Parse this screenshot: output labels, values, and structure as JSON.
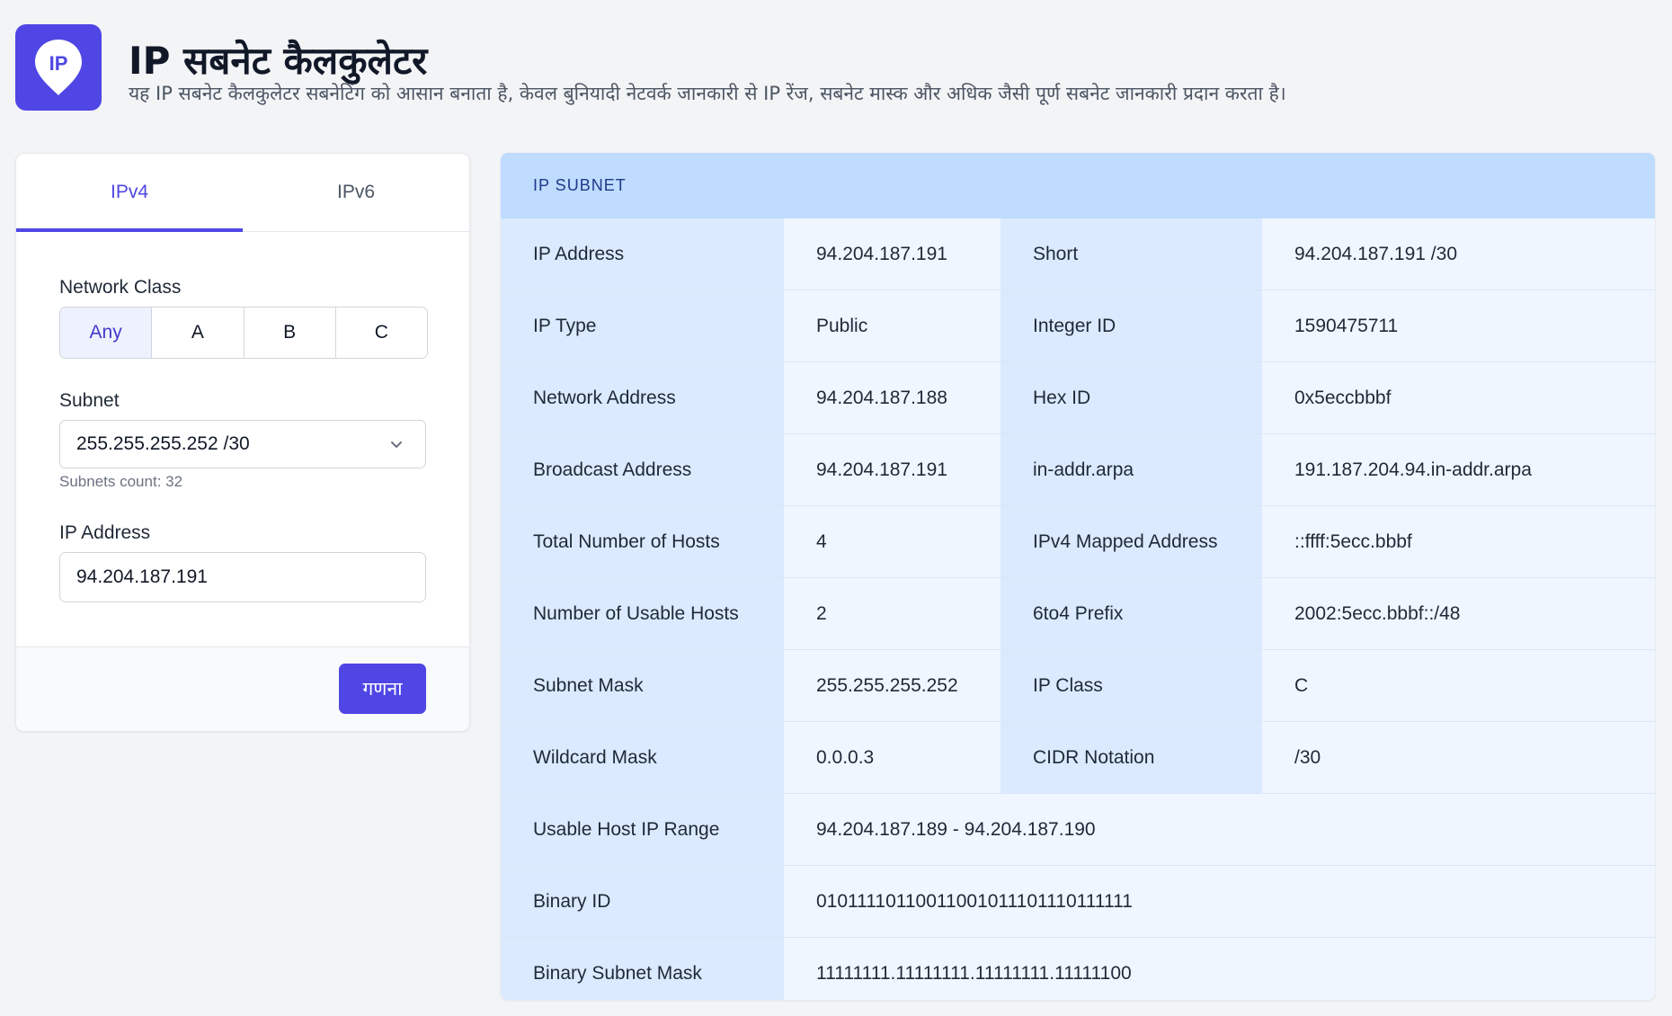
{
  "header": {
    "logo_text": "IP",
    "title": "IP सबनेट कैलकुलेटर",
    "subtitle": "यह IP सबनेट कैलकुलेटर सबनेटिंग को आसान बनाता है, केवल बुनियादी नेटवर्क जानकारी से IP रेंज, सबनेट मास्क और अधिक जैसी पूर्ण सबनेट जानकारी प्रदान करता है।"
  },
  "form": {
    "tabs": [
      {
        "label": "IPv4",
        "active": true
      },
      {
        "label": "IPv6",
        "active": false
      }
    ],
    "network_class_label": "Network Class",
    "network_class_options": [
      "Any",
      "A",
      "B",
      "C"
    ],
    "network_class_selected": "Any",
    "subnet_label": "Subnet",
    "subnet_value": "255.255.255.252 /30",
    "subnets_count": "Subnets count: 32",
    "ip_address_label": "IP Address",
    "ip_address_value": "94.204.187.191",
    "calculate_label": "गणना"
  },
  "result": {
    "heading": "IP SUBNET",
    "rows": [
      {
        "k1": "IP Address",
        "v1": "94.204.187.191",
        "k2": "Short",
        "v2": "94.204.187.191 /30"
      },
      {
        "k1": "IP Type",
        "v1": "Public",
        "k2": "Integer ID",
        "v2": "1590475711"
      },
      {
        "k1": "Network Address",
        "v1": "94.204.187.188",
        "k2": "Hex ID",
        "v2": "0x5eccbbbf"
      },
      {
        "k1": "Broadcast Address",
        "v1": "94.204.187.191",
        "k2": "in-addr.arpa",
        "v2": "191.187.204.94.in-addr.arpa"
      },
      {
        "k1": "Total Number of Hosts",
        "v1": "4",
        "k2": "IPv4 Mapped Address",
        "v2": "::ffff:5ecc.bbbf"
      },
      {
        "k1": "Number of Usable Hosts",
        "v1": "2",
        "k2": "6to4 Prefix",
        "v2": "2002:5ecc.bbbf::/48"
      },
      {
        "k1": "Subnet Mask",
        "v1": "255.255.255.252",
        "k2": "IP Class",
        "v2": "C"
      },
      {
        "k1": "Wildcard Mask",
        "v1": "0.0.0.3",
        "k2": "CIDR Notation",
        "v2": "/30"
      }
    ],
    "wide_rows": [
      {
        "k": "Usable Host IP Range",
        "v": "94.204.187.189 - 94.204.187.190"
      },
      {
        "k": "Binary ID",
        "v": "01011110110011001011101110111111"
      },
      {
        "k": "Binary Subnet Mask",
        "v": "11111111.11111111.11111111.11111100"
      }
    ]
  },
  "colors": {
    "accent": "#4f46e5",
    "panel_header": "#bfdbfe",
    "key_cell": "#dbeafe",
    "value_cell": "#eff6ff"
  }
}
